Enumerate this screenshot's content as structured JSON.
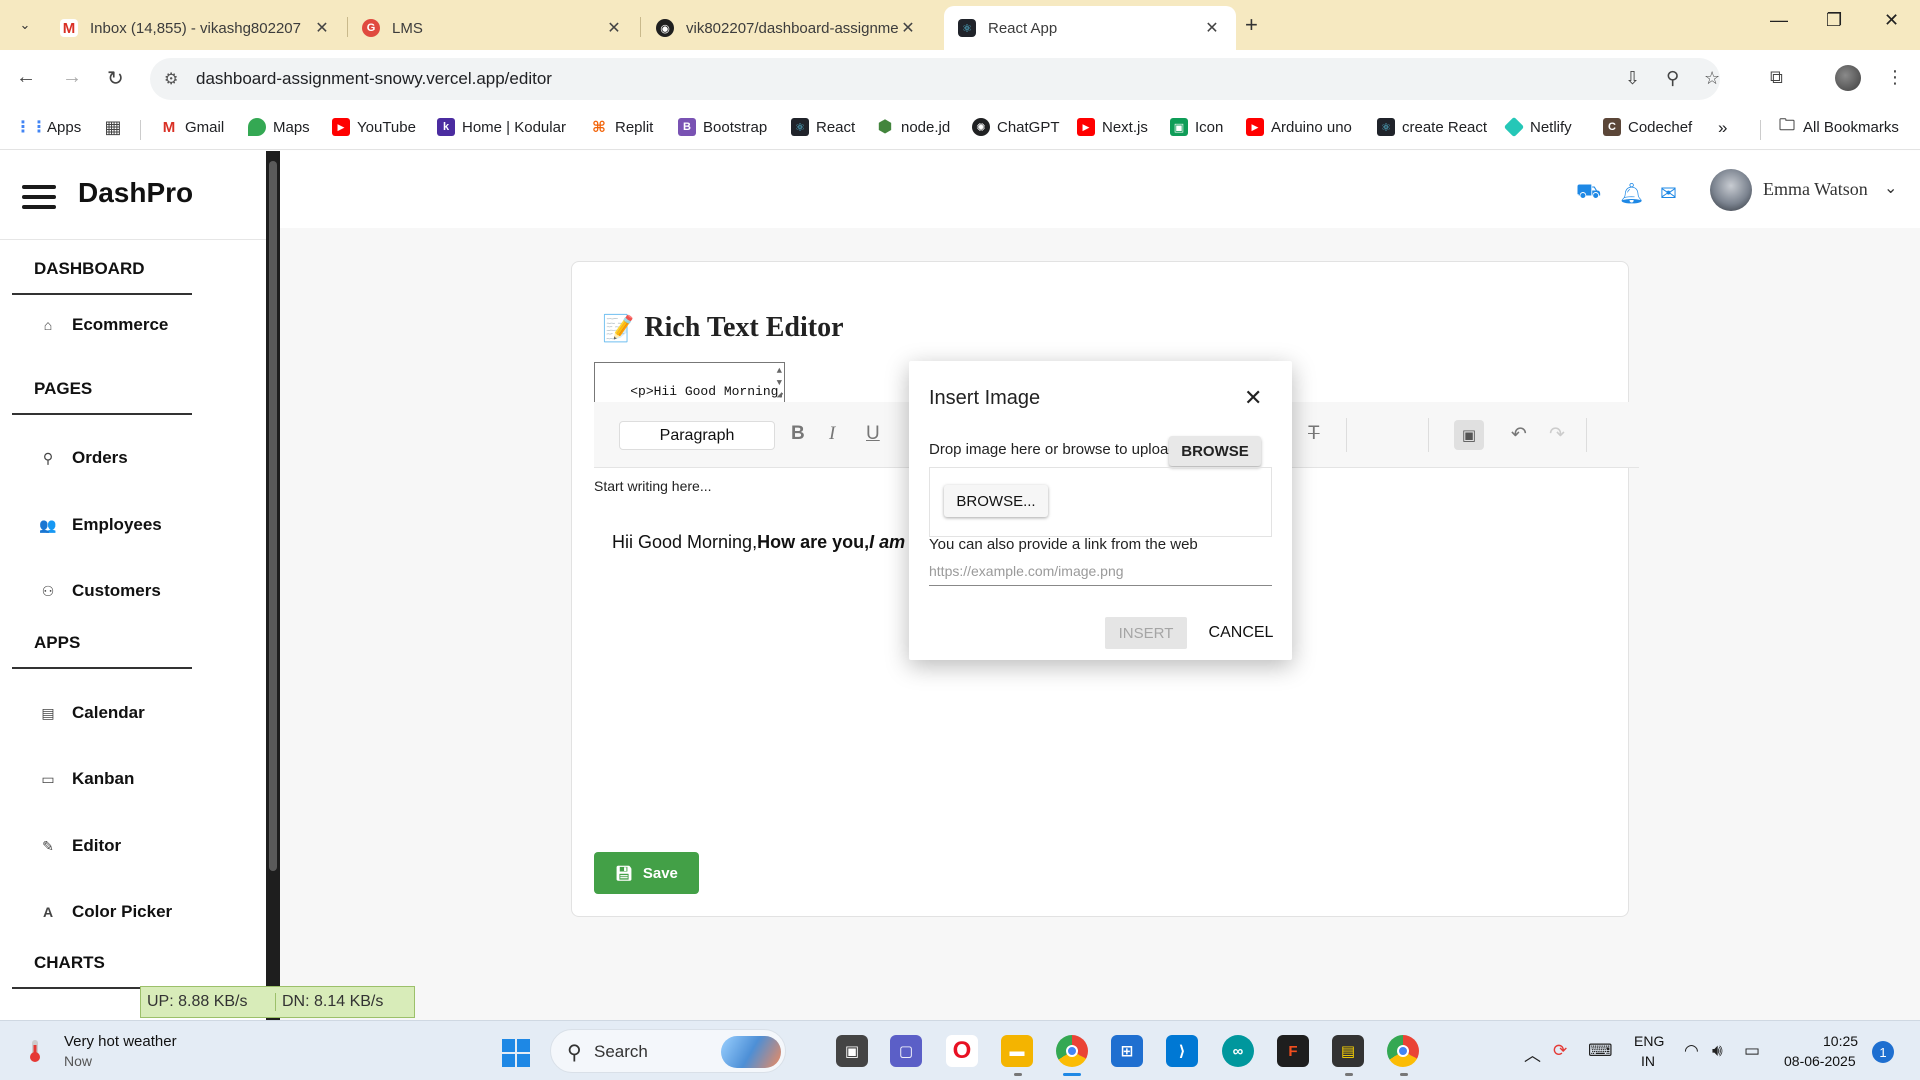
{
  "browser": {
    "tabs": [
      {
        "title": "Inbox (14,855) - vikashg802207",
        "color": "#d93025",
        "glyph": "M"
      },
      {
        "title": "LMS",
        "color": "#e04a3f",
        "glyph": "G"
      },
      {
        "title": "vik802207/dashboard-assignme",
        "color": "#1f1f1f",
        "glyph": "◉"
      },
      {
        "title": "React App",
        "color": "#20232a",
        "glyph": "⚛"
      }
    ],
    "url": "dashboard-assignment-snowy.vercel.app/editor",
    "bookmarks": [
      {
        "label": "Apps",
        "color": "#4285f4",
        "glyph": "▦"
      },
      {
        "label": "Gmail",
        "color": "#d93025",
        "glyph": "M"
      },
      {
        "label": "Maps",
        "color": "#34a853",
        "glyph": "◆"
      },
      {
        "label": "YouTube",
        "color": "#ff0000",
        "glyph": "▶"
      },
      {
        "label": "Home | Kodular",
        "color": "#4b2ca0",
        "glyph": "k"
      },
      {
        "label": "Replit",
        "color": "#f26207",
        "glyph": "⌘"
      },
      {
        "label": "Bootstrap",
        "color": "#7952b3",
        "glyph": "B"
      },
      {
        "label": "React",
        "color": "#20232a",
        "glyph": "⚛"
      },
      {
        "label": "node.jd",
        "color": "#43853d",
        "glyph": "⬢"
      },
      {
        "label": "ChatGPT",
        "color": "#202123",
        "glyph": "✺"
      },
      {
        "label": "Next.js",
        "color": "#ff0000",
        "glyph": "▶"
      },
      {
        "label": "Icon",
        "color": "#0f9d58",
        "glyph": "▣"
      },
      {
        "label": "Arduino uno",
        "color": "#ff0000",
        "glyph": "▶"
      },
      {
        "label": "create React",
        "color": "#20232a",
        "glyph": "⚛"
      },
      {
        "label": "Netlify",
        "color": "#25c7b7",
        "glyph": "◆"
      },
      {
        "label": "Codechef",
        "color": "#5b4638",
        "glyph": "C"
      }
    ],
    "all_bookmarks": "All Bookmarks"
  },
  "sidebar": {
    "brand": "DashPro",
    "sections": [
      {
        "title": "DASHBOARD",
        "items": [
          {
            "label": "Ecommerce",
            "icon": "home-icon"
          }
        ]
      },
      {
        "title": "PAGES",
        "items": [
          {
            "label": "Orders",
            "icon": "location-pin-icon"
          },
          {
            "label": "Employees",
            "icon": "people-icon"
          },
          {
            "label": "Customers",
            "icon": "person-icon"
          }
        ]
      },
      {
        "title": "APPS",
        "items": [
          {
            "label": "Calendar",
            "icon": "calendar-icon"
          },
          {
            "label": "Kanban",
            "icon": "folder-icon"
          },
          {
            "label": "Editor",
            "icon": "pencil-icon"
          },
          {
            "label": "Color Picker",
            "icon": "font-icon"
          }
        ]
      },
      {
        "title": "CHARTS",
        "items": []
      }
    ]
  },
  "header": {
    "user_name": "Emma Watson",
    "icon_color": "#1e88e5"
  },
  "editor": {
    "title": "Rich Text Editor",
    "source_text": "<p>Hii Good Morning,\n<strong>How are",
    "block_format": "Paragraph",
    "placeholder": "Start writing here...",
    "content_plain": "Hii Good Morning,",
    "content_bold": "How are you,",
    "content_bold_italic": "I am f",
    "save_label": "Save",
    "save_color": "#43a047"
  },
  "dialog": {
    "title": "Insert Image",
    "drop_text": "Drop image here or browse to upload",
    "browse_top_label": "BROWSE",
    "browse_label": "BROWSE...",
    "link_label": "You can also provide a link from the web",
    "link_placeholder": "https://example.com/image.png",
    "insert_label": "INSERT",
    "cancel_label": "CANCEL"
  },
  "netmeter": {
    "up": "UP: 8.88 KB/s",
    "down": "DN: 8.14 KB/s"
  },
  "taskbar": {
    "weather_title": "Very hot weather",
    "weather_sub": "Now",
    "search_label": "Search",
    "lang_line1": "ENG",
    "lang_line2": "IN",
    "time": "10:25",
    "date": "08-06-2025",
    "notification_count": "1"
  }
}
